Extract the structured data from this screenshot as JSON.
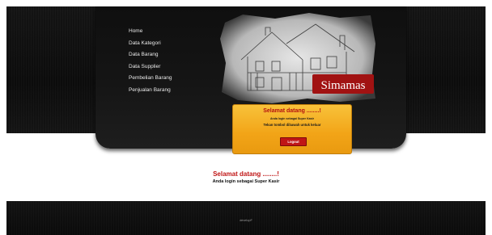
{
  "nav": {
    "items": [
      {
        "label": "Home"
      },
      {
        "label": "Data Kategori"
      },
      {
        "label": "Data Barang"
      },
      {
        "label": "Data Supplier"
      },
      {
        "label": "Pembelian Barang"
      },
      {
        "label": "Penjualan Barang"
      }
    ]
  },
  "header": {
    "logo_text": "Simamas",
    "art_icon": "house-sketch-icon"
  },
  "welcome_box": {
    "title": "Selamat datang ........!",
    "subtitle": "Anda login sebagai Super Kasir",
    "note": "Tekan tombol dibawah untuk keluar",
    "logout_label": "Logout"
  },
  "main": {
    "welcome_title": "Selamat datang ........!",
    "welcome_subtitle": "Anda login sebagai Super Kasir"
  },
  "footer": {
    "text": "developF"
  },
  "colors": {
    "accent_red": "#c01616",
    "box_orange": "#f2a417",
    "dark_bg": "#0c0c0c"
  }
}
